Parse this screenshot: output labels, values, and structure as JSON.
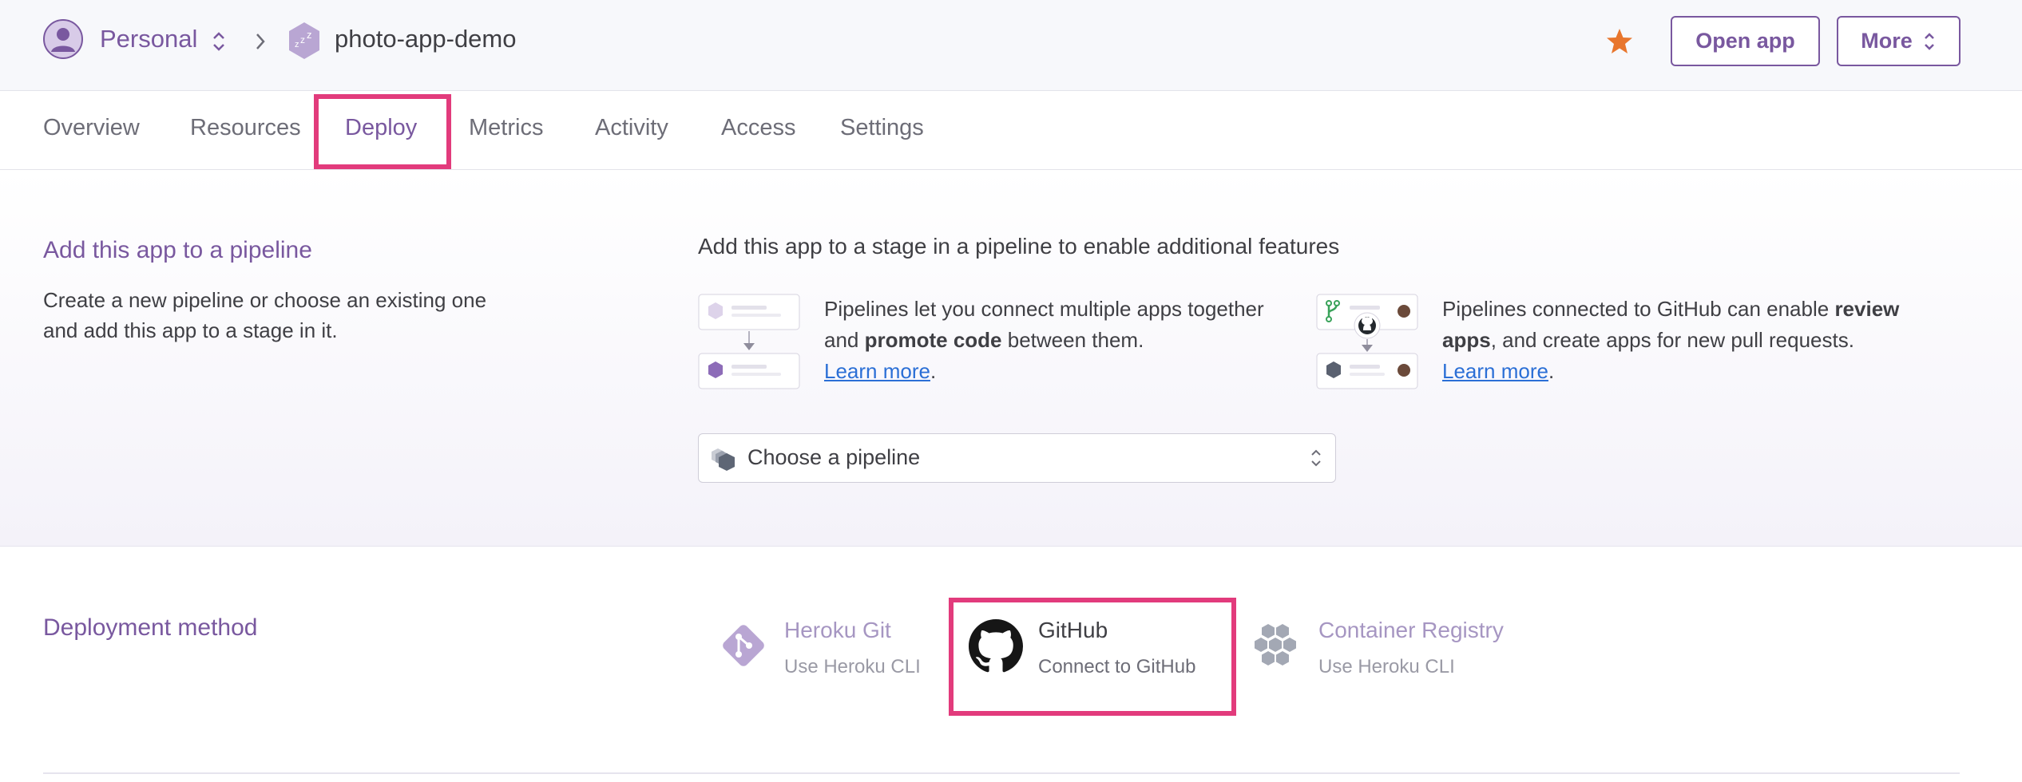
{
  "header": {
    "team_name": "Personal",
    "app_name": "photo-app-demo",
    "open_app_label": "Open app",
    "more_label": "More",
    "colors": {
      "accent": "#79589f",
      "star": "#e8762d",
      "highlight": "#e23b7c"
    }
  },
  "tabs": [
    {
      "label": "Overview"
    },
    {
      "label": "Resources"
    },
    {
      "label": "Deploy",
      "active": true
    },
    {
      "label": "Metrics"
    },
    {
      "label": "Activity"
    },
    {
      "label": "Access"
    },
    {
      "label": "Settings"
    }
  ],
  "pipeline": {
    "title": "Add this app to a pipeline",
    "description": "Create a new pipeline or choose an existing one and add this app to a stage in it.",
    "heading": "Add this app to a stage in a pipeline to enable additional features",
    "feature1": {
      "text_before": "Pipelines let you connect multiple apps together and ",
      "bold": "promote code",
      "text_after": " between them.",
      "link": "Learn more"
    },
    "feature2": {
      "text_before": "Pipelines connected to GitHub can enable ",
      "bold": "review apps",
      "text_after": ", and create apps for new pull requests.",
      "link": "Learn more"
    },
    "select_placeholder": "Choose a pipeline"
  },
  "deployment": {
    "title": "Deployment method",
    "methods": [
      {
        "name": "Heroku Git",
        "sub": "Use Heroku CLI",
        "icon": "heroku-git-icon"
      },
      {
        "name": "GitHub",
        "sub": "Connect to GitHub",
        "icon": "github-icon",
        "selected": true
      },
      {
        "name": "Container Registry",
        "sub": "Use Heroku CLI",
        "icon": "container-registry-icon"
      }
    ]
  }
}
